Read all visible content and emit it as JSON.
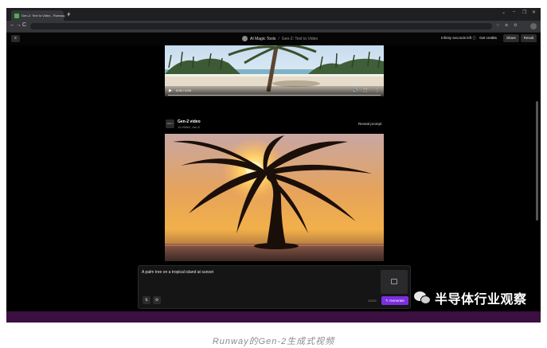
{
  "browser": {
    "tab_title": "Gen-2: Text to Video - Runway",
    "tab_close": "×",
    "new_tab": "+",
    "window_controls": [
      "⌄",
      "–",
      "❐",
      "✕"
    ],
    "nav": [
      "←",
      "→",
      "C"
    ],
    "toolbar_icons": [
      "☆",
      "⊕",
      "⚙"
    ]
  },
  "header": {
    "sidebar_toggle": "≡",
    "app_name": "AI Magic Tools",
    "separator": "/",
    "page_name": "Gen-2: Text to Video",
    "credits": "Infinity seconds left ⓘ",
    "get_credits": "Get credits",
    "share": "Share",
    "result": "Result"
  },
  "video1": {
    "play": "▶",
    "time": "0:00 / 0:04",
    "icons": [
      "🔊",
      "⛶",
      "⋮"
    ]
  },
  "card": {
    "avatar": "GEN-2",
    "title": "Gen-2 video",
    "time": "11:05AM, Jun 8",
    "reveal": "Reveal prompt"
  },
  "prompt": {
    "text": "A palm tree on a tropical island at sunset",
    "counter": "42/320",
    "tool1": "⇅",
    "tool2": "⚙",
    "generate": "✎ Generate"
  },
  "watermark": {
    "text": "半导体行业观察"
  },
  "caption": "Runway的Gen-2生成式视频",
  "colors": {
    "accent": "#7c2fe0",
    "bottom_bar": "#3b1040",
    "page_bg": "#000000"
  }
}
